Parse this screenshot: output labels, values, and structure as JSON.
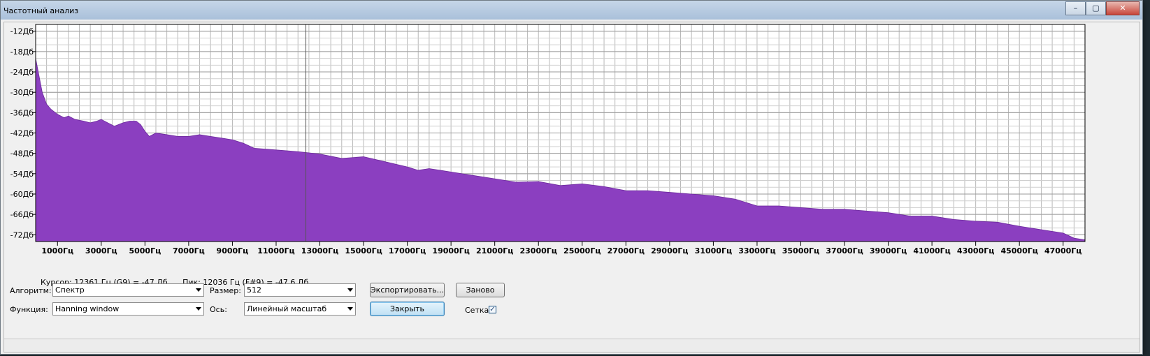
{
  "window": {
    "title": "Частотный анализ",
    "minimize_glyph": "–",
    "maximize_glyph": "▢",
    "close_glyph": "✕"
  },
  "chart_data": {
    "type": "area",
    "xlabel": "",
    "ylabel": "",
    "xlim": [
      0,
      48000
    ],
    "ylim": [
      -74,
      -10
    ],
    "grid": true,
    "y_ticks": [
      "-12Дб",
      "-18Дб",
      "-24Дб",
      "-30Дб",
      "-36Дб",
      "-42Дб",
      "-48Дб",
      "-54Дб",
      "-60Дб",
      "-66Дб",
      "-72Дб"
    ],
    "y_tick_values": [
      -12,
      -18,
      -24,
      -30,
      -36,
      -42,
      -48,
      -54,
      -60,
      -66,
      -72
    ],
    "x_ticks": [
      "1000Гц",
      "3000Гц",
      "5000Гц",
      "7000Гц",
      "9000Гц",
      "11000Гц",
      "13000Гц",
      "15000Гц",
      "17000Гц",
      "19000Гц",
      "21000Гц",
      "23000Гц",
      "25000Гц",
      "27000Гц",
      "29000Гц",
      "31000Гц",
      "33000Гц",
      "35000Гц",
      "37000Гц",
      "39000Гц",
      "41000Гц",
      "43000Гц",
      "45000Гц",
      "47000Гц"
    ],
    "x_tick_values": [
      1000,
      3000,
      5000,
      7000,
      9000,
      11000,
      13000,
      15000,
      17000,
      19000,
      21000,
      23000,
      25000,
      27000,
      29000,
      31000,
      33000,
      35000,
      37000,
      39000,
      41000,
      43000,
      45000,
      47000
    ],
    "fill_color": "#8b3fc0",
    "points": [
      [
        0,
        -20
      ],
      [
        150,
        -25
      ],
      [
        300,
        -30
      ],
      [
        500,
        -33.5
      ],
      [
        700,
        -35
      ],
      [
        1000,
        -36.5
      ],
      [
        1300,
        -37.5
      ],
      [
        1500,
        -37
      ],
      [
        1800,
        -38
      ],
      [
        2200,
        -38.5
      ],
      [
        2500,
        -39
      ],
      [
        2800,
        -38.5
      ],
      [
        3000,
        -38
      ],
      [
        3300,
        -39
      ],
      [
        3600,
        -40
      ],
      [
        4000,
        -39
      ],
      [
        4300,
        -38.5
      ],
      [
        4600,
        -38.5
      ],
      [
        4800,
        -39.5
      ],
      [
        5000,
        -41.5
      ],
      [
        5200,
        -43
      ],
      [
        5500,
        -42
      ],
      [
        6000,
        -42.5
      ],
      [
        6500,
        -43
      ],
      [
        7000,
        -43
      ],
      [
        7500,
        -42.5
      ],
      [
        8000,
        -43
      ],
      [
        8500,
        -43.5
      ],
      [
        9000,
        -44
      ],
      [
        9500,
        -45
      ],
      [
        10000,
        -46.5
      ],
      [
        11000,
        -47
      ],
      [
        12000,
        -47.5
      ],
      [
        13000,
        -48.2
      ],
      [
        14000,
        -49.5
      ],
      [
        15000,
        -49
      ],
      [
        16000,
        -50.5
      ],
      [
        17000,
        -52
      ],
      [
        17500,
        -53
      ],
      [
        18000,
        -52.5
      ],
      [
        19000,
        -53.5
      ],
      [
        20000,
        -54.5
      ],
      [
        21000,
        -55.5
      ],
      [
        22000,
        -56.5
      ],
      [
        23000,
        -56.3
      ],
      [
        24000,
        -57.5
      ],
      [
        25000,
        -57
      ],
      [
        26000,
        -57.8
      ],
      [
        27000,
        -59
      ],
      [
        28000,
        -59
      ],
      [
        29000,
        -59.5
      ],
      [
        30000,
        -60
      ],
      [
        31000,
        -60.5
      ],
      [
        32000,
        -61.5
      ],
      [
        33000,
        -63.5
      ],
      [
        34000,
        -63.5
      ],
      [
        35000,
        -64
      ],
      [
        36000,
        -64.5
      ],
      [
        37000,
        -64.5
      ],
      [
        38000,
        -65
      ],
      [
        39000,
        -65.5
      ],
      [
        40000,
        -66.5
      ],
      [
        41000,
        -66.5
      ],
      [
        42000,
        -67.5
      ],
      [
        43000,
        -68
      ],
      [
        44000,
        -68.3
      ],
      [
        45000,
        -69.5
      ],
      [
        46000,
        -70.5
      ],
      [
        47000,
        -71.5
      ],
      [
        47500,
        -73
      ],
      [
        48000,
        -73.5
      ]
    ]
  },
  "info": {
    "cursor": "Курсор: 12361 Гц (G9) = -47 Дб",
    "peak": "Пик: 12036 Гц (F#9) = -47,6 Дб"
  },
  "controls": {
    "algorithm_label": "Алгоритм:",
    "algorithm_value": "Спектр",
    "function_label": "Функция:",
    "function_value": "Hanning window",
    "size_label": "Размер:",
    "size_value": "512",
    "axis_label": "Ось:",
    "axis_value": "Линейный масштаб",
    "export_button": "Экспортировать...",
    "replot_button": "Заново",
    "close_button": "Закрыть",
    "grid_label": "Сетка",
    "grid_checked_glyph": "✓"
  }
}
